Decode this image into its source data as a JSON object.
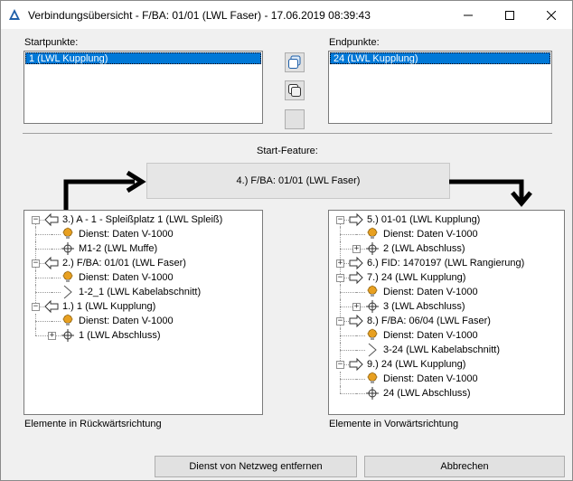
{
  "window": {
    "title": "Verbindungsübersicht - F/BA: 01/01 (LWL Faser) - 17.06.2019 08:39:43",
    "minimize_label": "—",
    "maximize_label": "☐",
    "close_label": "✕"
  },
  "start_points": {
    "label": "Startpunkte:",
    "selected": "1 (LWL Kupplung)"
  },
  "end_points": {
    "label": "Endpunkte:",
    "selected": "24 (LWL Kupplung)"
  },
  "start_feature": {
    "label": "Start-Feature:",
    "value": "4.) F/BA: 01/01 (LWL Faser)"
  },
  "backward_tree": {
    "caption": "Elemente in Rückwärtsrichtung",
    "rows": [
      {
        "text": "3.) A - 1 - Spleißplatz 1 (LWL Spleiß)",
        "icon": "arrow-left-icon",
        "level": 0,
        "expander": "−"
      },
      {
        "text": "Dienst: Daten V-1000",
        "icon": "lightbulb-icon",
        "level": 1,
        "expander": ""
      },
      {
        "text": "M1-2 (LWL Muffe)",
        "icon": "crosshair-icon",
        "level": 1,
        "expander": ""
      },
      {
        "text": "2.) F/BA: 01/01 (LWL Faser)",
        "icon": "arrow-left-icon",
        "level": 0,
        "expander": "−"
      },
      {
        "text": "Dienst: Daten V-1000",
        "icon": "lightbulb-icon",
        "level": 1,
        "expander": ""
      },
      {
        "text": "1-2_1 (LWL Kabelabschnitt)",
        "icon": "cable-section-icon",
        "level": 1,
        "expander": ""
      },
      {
        "text": "1.) 1 (LWL Kupplung)",
        "icon": "arrow-left-icon",
        "level": 0,
        "expander": "−"
      },
      {
        "text": "Dienst: Daten V-1000",
        "icon": "lightbulb-icon",
        "level": 1,
        "expander": ""
      },
      {
        "text": "1 (LWL Abschluss)",
        "icon": "crosshair-icon",
        "level": 1,
        "expander": "+"
      }
    ]
  },
  "forward_tree": {
    "caption": "Elemente in Vorwärtsrichtung",
    "rows": [
      {
        "text": "5.) 01-01 (LWL Kupplung)",
        "icon": "arrow-right-icon",
        "level": 0,
        "expander": "−"
      },
      {
        "text": "Dienst: Daten V-1000",
        "icon": "lightbulb-icon",
        "level": 1,
        "expander": ""
      },
      {
        "text": "2 (LWL Abschluss)",
        "icon": "crosshair-icon",
        "level": 1,
        "expander": "+"
      },
      {
        "text": "6.) FID: 1470197 (LWL Rangierung)",
        "icon": "arrow-right-icon",
        "level": 0,
        "expander": "+"
      },
      {
        "text": "7.) 24 (LWL Kupplung)",
        "icon": "arrow-right-icon",
        "level": 0,
        "expander": "−"
      },
      {
        "text": "Dienst: Daten V-1000",
        "icon": "lightbulb-icon",
        "level": 1,
        "expander": ""
      },
      {
        "text": "3 (LWL Abschluss)",
        "icon": "crosshair-icon",
        "level": 1,
        "expander": "+"
      },
      {
        "text": "8.) F/BA: 06/04 (LWL Faser)",
        "icon": "arrow-right-icon",
        "level": 0,
        "expander": "−"
      },
      {
        "text": "Dienst: Daten V-1000",
        "icon": "lightbulb-icon",
        "level": 1,
        "expander": ""
      },
      {
        "text": "3-24 (LWL Kabelabschnitt)",
        "icon": "cable-section-icon",
        "level": 1,
        "expander": ""
      },
      {
        "text": "9.) 24 (LWL Kupplung)",
        "icon": "arrow-right-icon",
        "level": 0,
        "expander": "−"
      },
      {
        "text": "Dienst: Daten V-1000",
        "icon": "lightbulb-icon",
        "level": 1,
        "expander": ""
      },
      {
        "text": "24 (LWL Abschluss)",
        "icon": "crosshair-icon",
        "level": 1,
        "expander": ""
      }
    ]
  },
  "buttons": {
    "remove_service": "Dienst von Netzweg entfernen",
    "cancel": "Abbrechen"
  },
  "colors": {
    "selection": "#0078d7",
    "window_bg": "#f0f0f0",
    "bulb": "#e8a020"
  }
}
